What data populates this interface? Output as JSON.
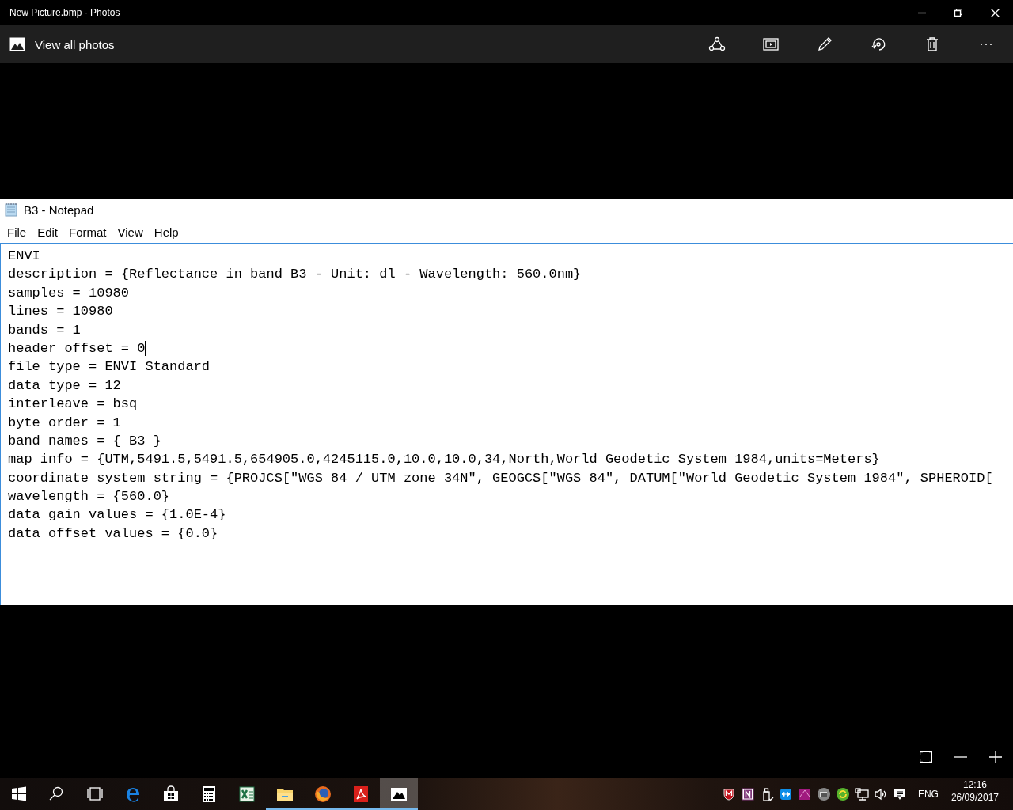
{
  "window": {
    "title": "New Picture.bmp - Photos"
  },
  "toolbar": {
    "back_label": "View all photos"
  },
  "notepad": {
    "title": "B3 - Notepad",
    "menu": [
      "File",
      "Edit",
      "Format",
      "View",
      "Help"
    ],
    "lines": [
      {
        "text": "ENVI",
        "cursor": false
      },
      {
        "text": "description = {Reflectance in band B3 - Unit: dl - Wavelength: 560.0nm}",
        "cursor": false
      },
      {
        "text": "samples = 10980",
        "cursor": false
      },
      {
        "text": "lines = 10980",
        "cursor": false
      },
      {
        "text": "bands = 1",
        "cursor": false
      },
      {
        "text": "header offset = 0",
        "cursor": true
      },
      {
        "text": "file type = ENVI Standard",
        "cursor": false
      },
      {
        "text": "data type = 12",
        "cursor": false
      },
      {
        "text": "interleave = bsq",
        "cursor": false
      },
      {
        "text": "byte order = 1",
        "cursor": false
      },
      {
        "text": "band names = { B3 }",
        "cursor": false
      },
      {
        "text": "map info = {UTM,5491.5,5491.5,654905.0,4245115.0,10.0,10.0,34,North,World Geodetic System 1984,units=Meters}",
        "cursor": false
      },
      {
        "text": "coordinate system string = {PROJCS[\"WGS 84 / UTM zone 34N\", GEOGCS[\"WGS 84\", DATUM[\"World Geodetic System 1984\", SPHEROID[",
        "cursor": false
      },
      {
        "text": "wavelength = {560.0}",
        "cursor": false
      },
      {
        "text": "data gain values = {1.0E-4}",
        "cursor": false
      },
      {
        "text": "data offset values = {0.0}",
        "cursor": false
      }
    ]
  },
  "taskbar": {
    "apps": [
      {
        "kind": "start",
        "running": false,
        "active": false
      },
      {
        "kind": "search",
        "running": false,
        "active": false
      },
      {
        "kind": "taskview",
        "running": false,
        "active": false
      },
      {
        "kind": "edge",
        "running": false,
        "active": false
      },
      {
        "kind": "store",
        "running": false,
        "active": false
      },
      {
        "kind": "calculator",
        "running": false,
        "active": false
      },
      {
        "kind": "excel",
        "running": false,
        "active": false
      },
      {
        "kind": "explorer",
        "running": true,
        "active": false
      },
      {
        "kind": "firefox",
        "running": true,
        "active": false
      },
      {
        "kind": "acrobat",
        "running": true,
        "active": false
      },
      {
        "kind": "photos",
        "running": true,
        "active": true
      }
    ],
    "tray": [
      {
        "kind": "shield"
      },
      {
        "kind": "notebook"
      },
      {
        "kind": "usb"
      },
      {
        "kind": "remote"
      },
      {
        "kind": "app"
      },
      {
        "kind": "windows"
      },
      {
        "kind": "sync"
      },
      {
        "kind": "network"
      },
      {
        "kind": "volume"
      },
      {
        "kind": "notifications"
      }
    ],
    "language": "ENG",
    "time": "12:16",
    "date": "26/09/2017"
  }
}
